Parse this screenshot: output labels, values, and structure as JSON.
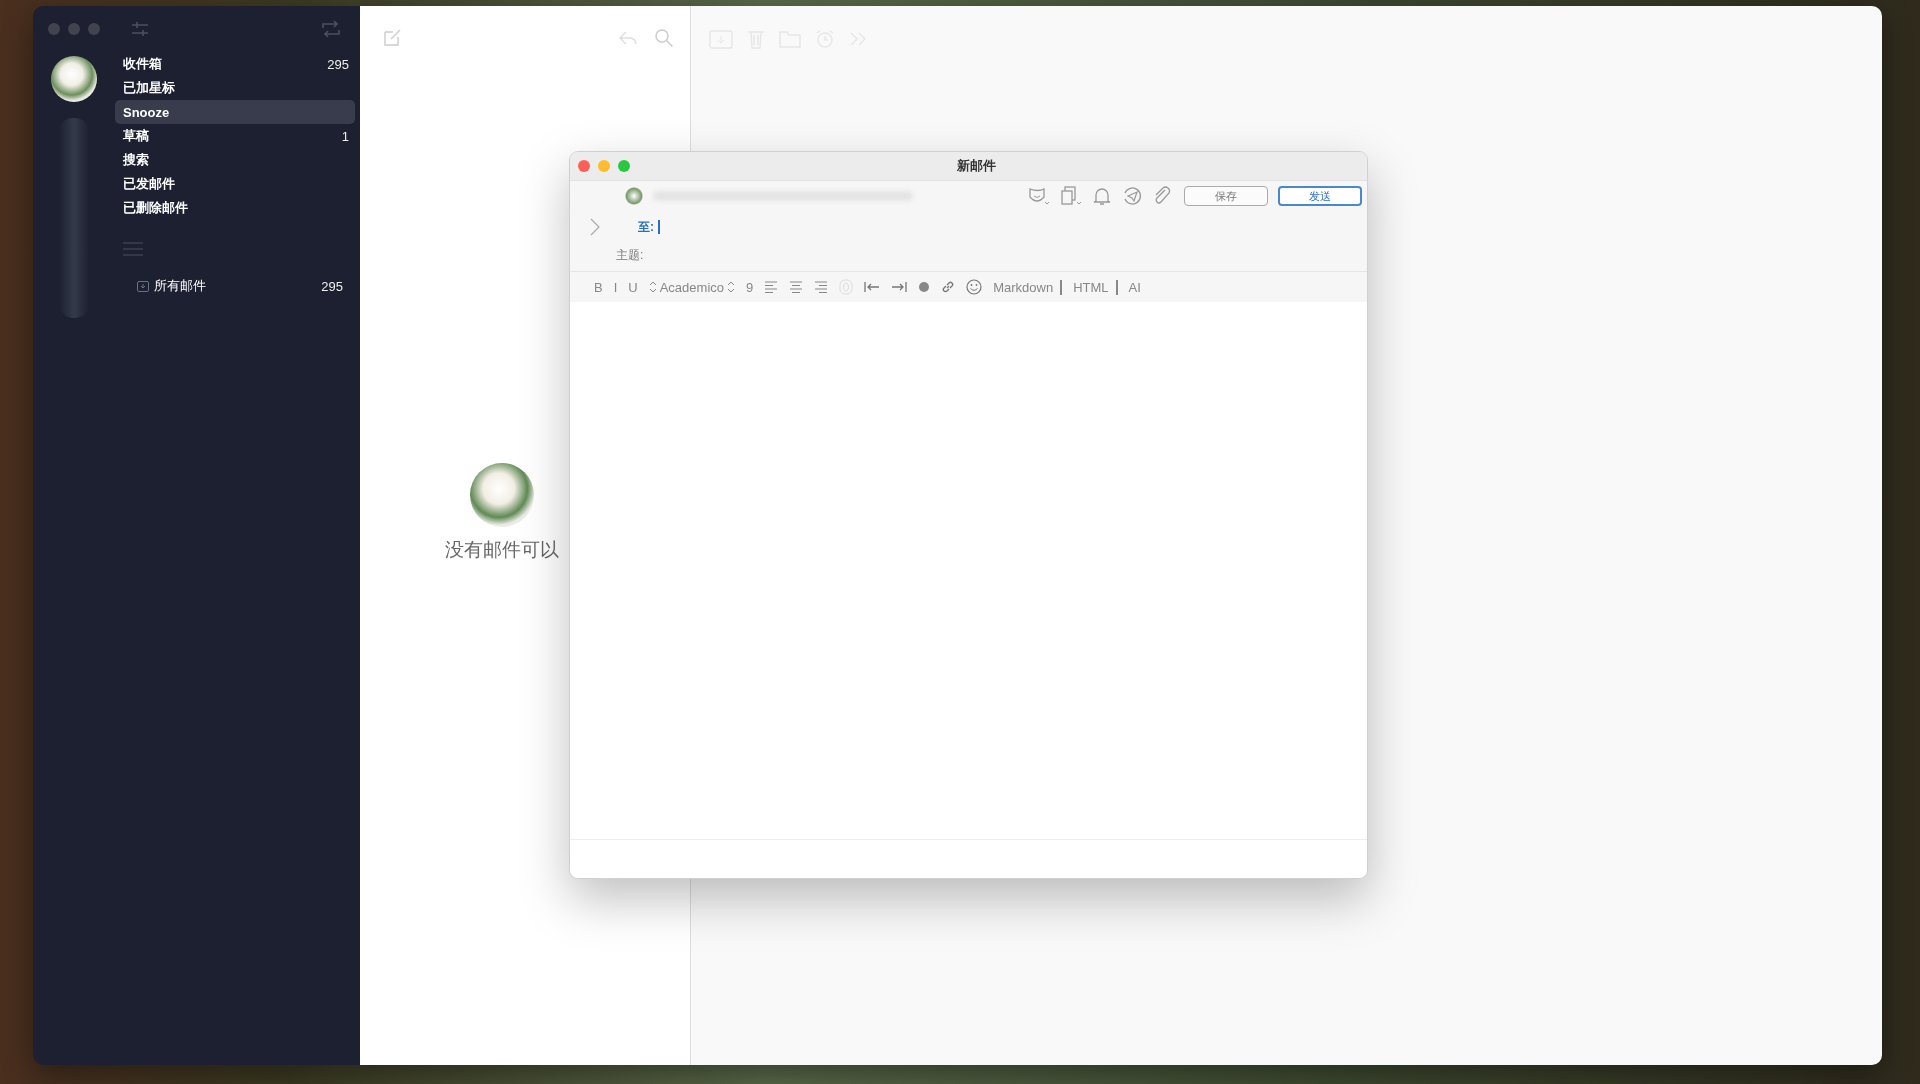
{
  "sidebar": {
    "mailboxes": [
      {
        "label": "收件箱",
        "count": "295",
        "selected": false
      },
      {
        "label": "已加星标",
        "selected": false
      },
      {
        "label": "Snooze",
        "selected": true
      },
      {
        "label": "草稿",
        "count": "1",
        "selected": false
      },
      {
        "label": "搜索",
        "selected": false
      },
      {
        "label": "已发邮件",
        "selected": false
      },
      {
        "label": "已删除邮件",
        "selected": false
      }
    ],
    "folders": [
      {
        "label": "所有邮件",
        "count": "295"
      }
    ]
  },
  "message_list": {
    "empty_text": "没有邮件可以"
  },
  "compose": {
    "title": "新邮件",
    "save": "保存",
    "send": "发送",
    "to_label": "至:",
    "subject_label": "主题:",
    "format_buttons": [
      "B",
      "I",
      "U"
    ],
    "font": "Academico",
    "size": "9",
    "modes": [
      "Markdown",
      "HTML",
      "AI"
    ]
  }
}
